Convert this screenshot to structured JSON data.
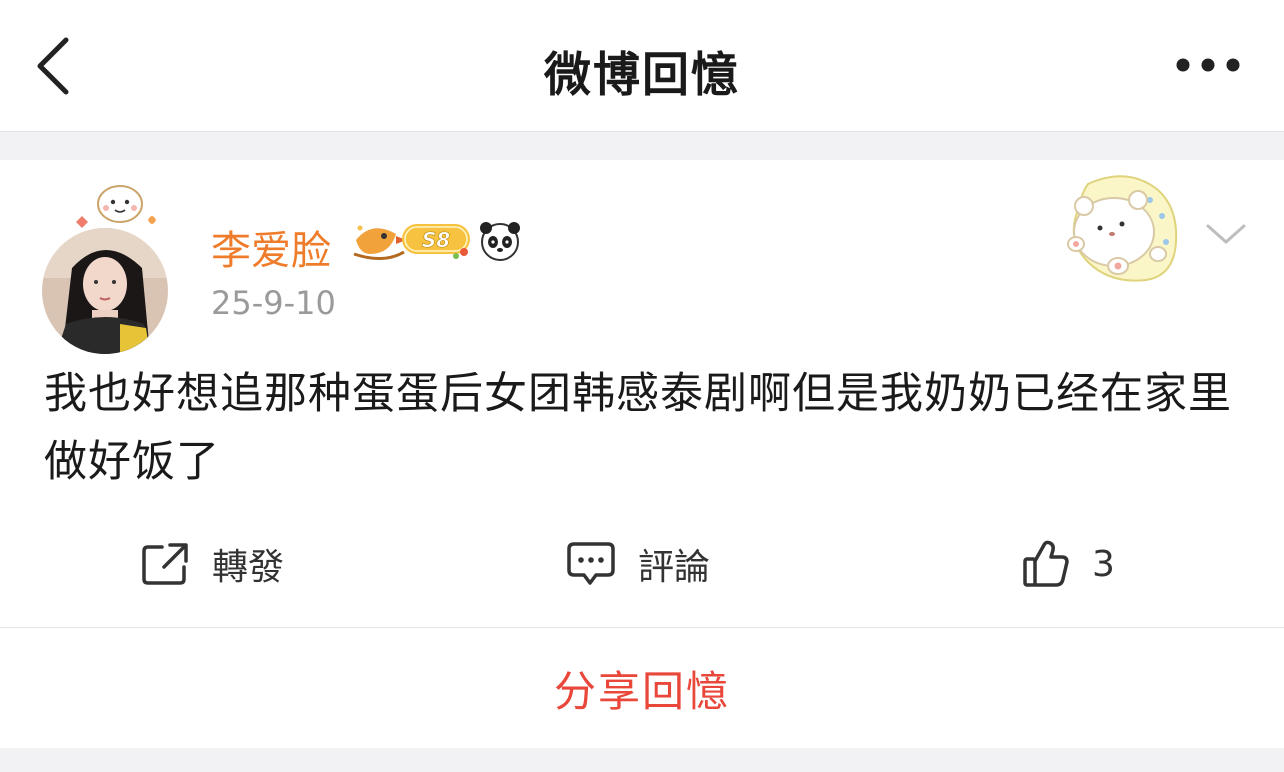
{
  "header": {
    "title": "微博回憶",
    "back_icon": "chevron-left-icon",
    "more_icon": "more-dots-icon"
  },
  "post": {
    "username": "李爱脸",
    "level_badge": "S8",
    "date": "25-9-10",
    "content": "我也好想追那种蛋蛋后女团韩感泰剧啊但是我奶奶已经在家里做好饭了",
    "username_color": "#ee7c2a"
  },
  "actions": {
    "repost_label": "轉發",
    "comment_label": "評論",
    "like_count": "3"
  },
  "footer": {
    "share_label": "分享回憶",
    "share_color": "#e8473a"
  }
}
